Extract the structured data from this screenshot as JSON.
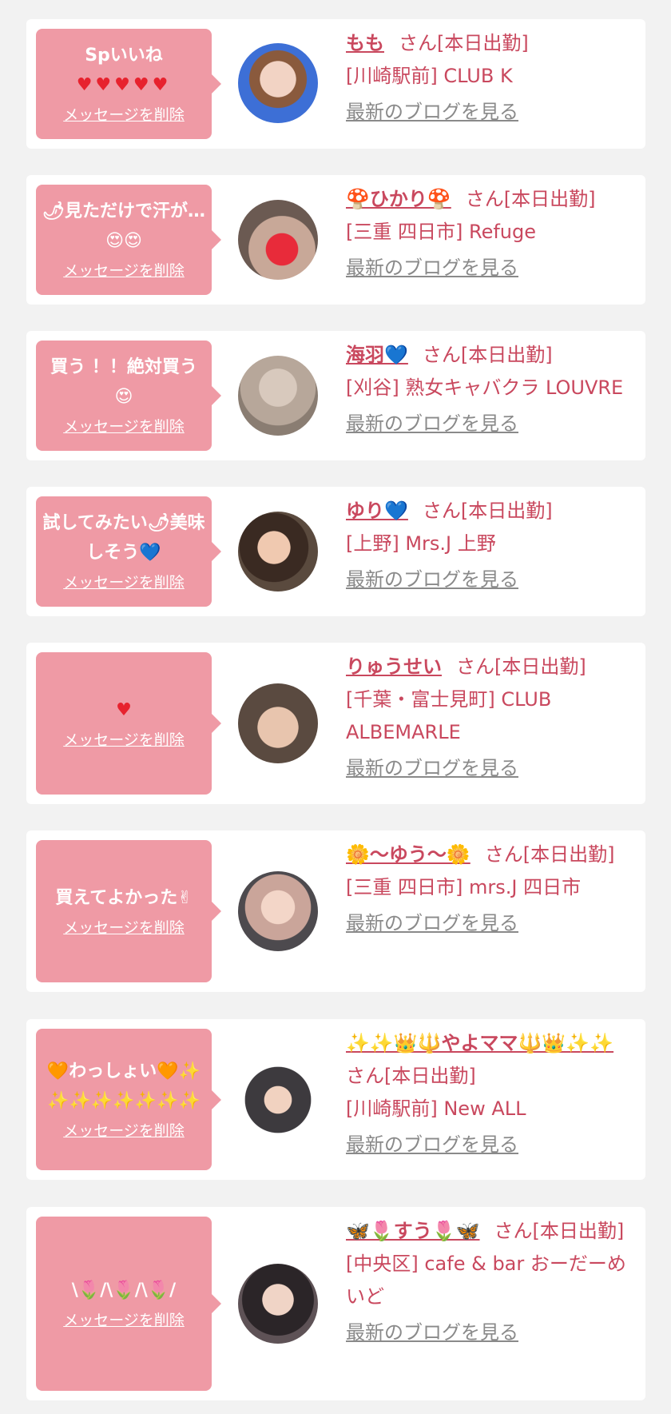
{
  "colors": {
    "bubble": "#ef9aa5",
    "name": "#c9485e",
    "link_gray": "#8a8a8a",
    "card": "#ffffff",
    "page_bg": "#f2f2f2"
  },
  "delete_label": "メッセージを削除",
  "san_label": "さん[本日出勤]",
  "blog_label": "最新のブログを見る",
  "items": [
    {
      "message": "Spいいね",
      "message2": "♥♥♥♥♥",
      "name": "もも",
      "shop": "[川崎駅前] CLUB K"
    },
    {
      "message": "🌶見ただけで汗が…😍😍",
      "name": "🍄ひかり🍄",
      "shop": "[三重 四日市] Refuge"
    },
    {
      "message": "買う ！！絶対買う😍",
      "name": "海羽💙",
      "shop": "[刈谷] 熟女キャバクラ LOUVRE"
    },
    {
      "message": "試してみたい🌶美味しそう💙",
      "name": "ゆり💙",
      "shop": "[上野] Mrs.J 上野"
    },
    {
      "message": "♥",
      "name": "りゅうせい",
      "shop": "[千葉・富士見町] CLUB ALBEMARLE"
    },
    {
      "message": "買えてよかった✌",
      "name": "🌼〜ゆう〜🌼",
      "shop": "[三重 四日市] mrs.J 四日市"
    },
    {
      "message": "🧡わっしょい🧡✨✨✨✨✨✨✨✨",
      "name": "✨✨👑🔱やよママ🔱👑✨✨",
      "shop": "[川崎駅前] New ALL"
    },
    {
      "message": "\\🌷/\\🌷/\\🌷/",
      "name": "🦋🌷すう🌷🦋",
      "shop": "[中央区] cafe & bar おーだーめいど"
    }
  ]
}
